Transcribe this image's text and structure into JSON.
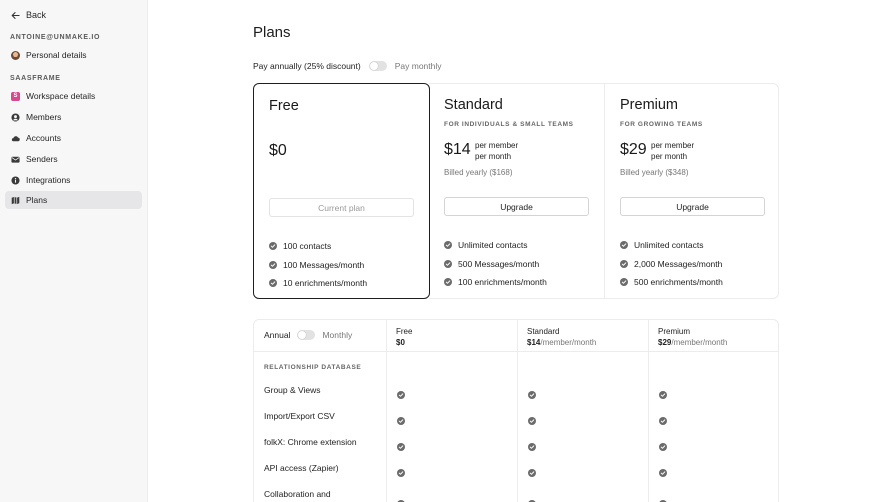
{
  "sidebar": {
    "back_label": "Back",
    "account_email": "ANTOINE@UNMAKE.IO",
    "personal_details": "Personal details",
    "workspace_section": "SAASFRAME",
    "workspace_badge": "S",
    "items": [
      {
        "label": "Workspace details",
        "icon": "workspace-badge"
      },
      {
        "label": "Members",
        "icon": "user-circle-icon"
      },
      {
        "label": "Accounts",
        "icon": "cloud-icon"
      },
      {
        "label": "Senders",
        "icon": "mail-icon"
      },
      {
        "label": "Integrations",
        "icon": "info-icon"
      },
      {
        "label": "Plans",
        "icon": "map-icon",
        "active": true
      }
    ]
  },
  "main": {
    "title": "Plans",
    "billing_toggle": {
      "annual": "Pay annually (25% discount)",
      "monthly": "Pay monthly"
    }
  },
  "plans": [
    {
      "name": "Free",
      "subtitle": "",
      "price": "$0",
      "per_line1": "",
      "per_line2": "",
      "billed": "",
      "button": "Current plan",
      "features": [
        "100 contacts",
        "100 Messages/month",
        "10 enrichments/month"
      ]
    },
    {
      "name": "Standard",
      "subtitle": "FOR INDIVIDUALS & SMALL TEAMS",
      "price": "$14",
      "per_line1": "per member",
      "per_line2": "per month",
      "billed": "Billed yearly ($168)",
      "button": "Upgrade",
      "features": [
        "Unlimited contacts",
        "500 Messages/month",
        "100 enrichments/month"
      ]
    },
    {
      "name": "Premium",
      "subtitle": "FOR GROWING TEAMS",
      "price": "$29",
      "per_line1": "per member",
      "per_line2": "per month",
      "billed": "Billed yearly ($348)",
      "button": "Upgrade",
      "features": [
        "Unlimited contacts",
        "2,000 Messages/month",
        "500 enrichments/month"
      ]
    }
  ],
  "comparison": {
    "toggle": {
      "annual": "Annual",
      "monthly": "Monthly"
    },
    "columns": [
      {
        "name": "Free",
        "price": "$0",
        "unit": ""
      },
      {
        "name": "Standard",
        "price": "$14",
        "unit": "/member/month"
      },
      {
        "name": "Premium",
        "price": "$29",
        "unit": "/member/month"
      }
    ],
    "category": "RELATIONSHIP DATABASE",
    "rows": [
      "Group & Views",
      "Import/Export CSV",
      "folkX: Chrome extension",
      "API access (Zapier)",
      "Collaboration and"
    ]
  },
  "colors": {
    "accent_badge": "#d9478c",
    "check": "#6b6b6b",
    "border": "#ececec"
  }
}
